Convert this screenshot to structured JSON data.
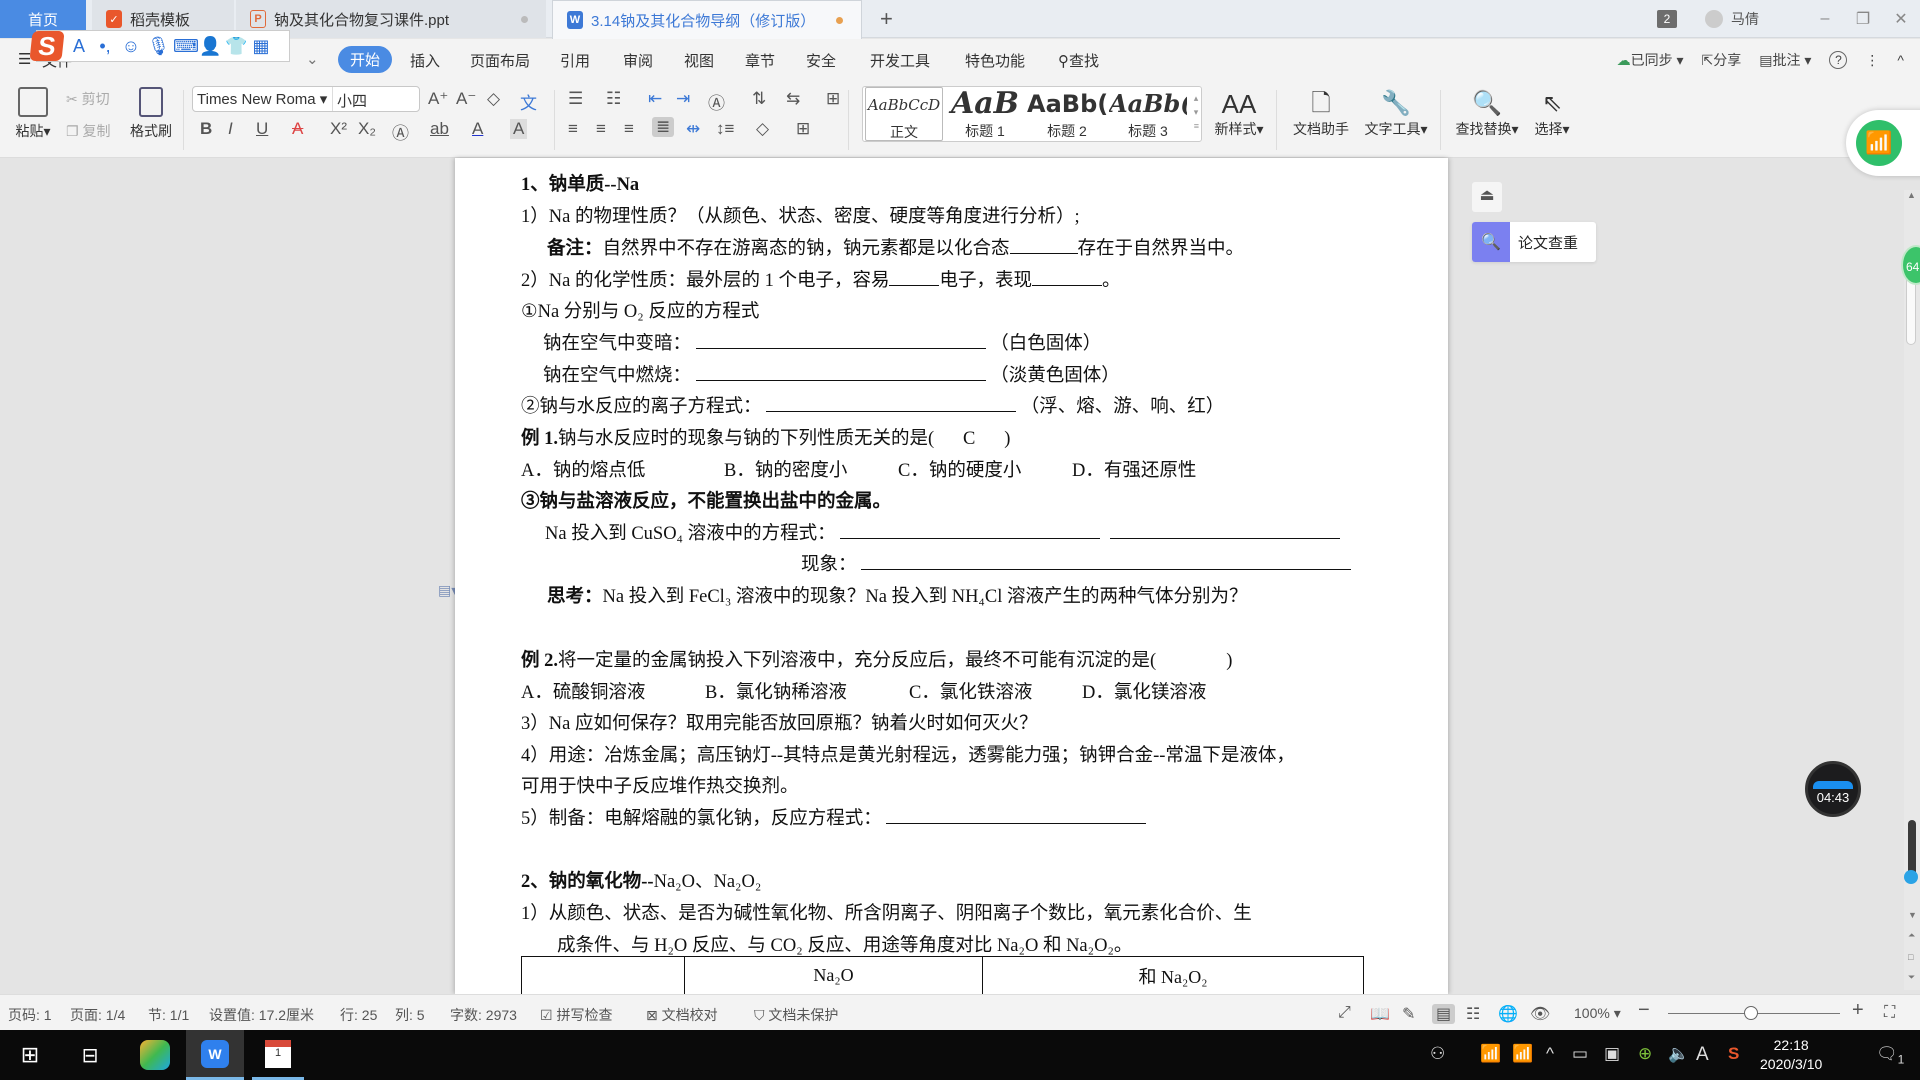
{
  "tabs": {
    "home": "首页",
    "items": [
      {
        "label": "稻壳模板",
        "icon": "docer-icon"
      },
      {
        "label": "钠及其化合物复习课件.ppt",
        "icon": "ppt-icon"
      },
      {
        "label": "3.14钠及其化合物导纲（修订版）",
        "icon": "word-icon",
        "active": true
      }
    ],
    "new_tab": "+"
  },
  "window": {
    "badge": "2",
    "user": "马倩",
    "min": "–",
    "restore": "❐",
    "close": "✕"
  },
  "menu": {
    "file": "文件",
    "items": [
      "开始",
      "插入",
      "页面布局",
      "引用",
      "审阅",
      "视图",
      "章节",
      "安全",
      "开发工具",
      "特色功能",
      "查找"
    ],
    "active": "开始",
    "right": {
      "sync": "已同步",
      "share": "分享",
      "comment": "批注",
      "help": "?",
      "more": "⋮",
      "collapse": "^"
    }
  },
  "ime": {
    "logo": "S"
  },
  "ribbon": {
    "paste": "粘贴",
    "cut": "剪切",
    "copy": "复制",
    "format_painter": "格式刷",
    "font_name": "Times New Roma",
    "font_size": "小四",
    "styles": [
      {
        "preview": "AaBbCcD",
        "label": "正文"
      },
      {
        "preview": "AaB",
        "label": "标题 1"
      },
      {
        "preview": "AaBb(",
        "label": "标题 2"
      },
      {
        "preview": "AaBb(",
        "label": "标题 3"
      }
    ],
    "new_style": "新样式",
    "doc_assistant": "文档助手",
    "text_tools": "文字工具",
    "find_replace": "查找替换",
    "select": "选择"
  },
  "document": {
    "h1": "1、钠单质--Na",
    "l1": "1）Na 的物理性质？（从颜色、状态、密度、硬度等角度进行分析）;",
    "note_label": "备注：",
    "note_a": "自然界中不存在游离态的钠，钠元素都是以化合态",
    "note_b": "存在于自然界当中。",
    "l2a": "2）Na 的化学性质：最外层的 1 个电子，容易",
    "l2b": "电子，表现",
    "l2c": "。",
    "o2_title": "①Na 分别与 O₂ 反应的方程式",
    "air_dark": "钠在空气中变暗：",
    "air_dark_hint": "（白色固体）",
    "air_burn": "钠在空气中燃烧：",
    "air_burn_hint": "（淡黄色固体）",
    "water": "②钠与水反应的离子方程式：",
    "water_hint": "（浮、熔、游、响、红）",
    "ex1_label": "例 1.",
    "ex1": "钠与水反应时的现象与钠的下列性质无关的是(",
    "ex1_answer": "C",
    "ex1_close": ")",
    "ex1_options": [
      "A．钠的熔点低",
      "B．钠的密度小",
      "C．钠的硬度小",
      "D．有强还原性"
    ],
    "salt": "③钠与盐溶液反应，不能置换出盐中的金属。",
    "cuso4": "Na 投入到 CuSO₄ 溶液中的方程式：",
    "phenomenon": "现象：",
    "think_label": "思考：",
    "think": "Na 投入到 FeCl₃ 溶液中的现象？Na 投入到 NH₄Cl 溶液产生的两种气体分别为？",
    "ex2_label": "例 2.",
    "ex2": "将一定量的金属钠投入下列溶液中，充分反应后，最终不可能有沉淀的是(",
    "ex2_close": ")",
    "ex2_options": [
      "A．硫酸铜溶液",
      "B．氯化钠稀溶液",
      "C．氯化铁溶液",
      "D．氯化镁溶液"
    ],
    "l3": "3）Na 应如何保存？取用完能否放回原瓶？钠着火时如何灭火？",
    "l4a": "4）用途：冶炼金属；高压钠灯--其特点是黄光射程远，透雾能力强；钠钾合金--常温下是液体，",
    "l4b": "可用于快中子反应堆作热交换剂。",
    "l5": "5）制备：电解熔融的氯化钠，反应方程式：",
    "h2_bold": "2、钠的氧化物--",
    "h2_rest": "Na₂O、Na₂O₂",
    "o1a": "1）从颜色、状态、是否为碱性氧化物、所含阴离子、阴阳离子个数比，氧元素化合价、生",
    "o1b": "成条件、与 H₂O 反应、与 CO₂ 反应、用途等角度对比 Na₂O 和 Na₂O₂。",
    "table_header": [
      "",
      "Na₂O",
      "和 Na₂O₂"
    ]
  },
  "side": {
    "collapse": "⏏",
    "paper_check": "论文查重",
    "timer": "04:43",
    "green_ball": "64"
  },
  "status": {
    "page_no": "页码: 1",
    "page": "页面: 1/4",
    "section": "节: 1/1",
    "setting": "设置值: 17.2厘米",
    "row": "行: 25",
    "col": "列: 5",
    "words": "字数: 2973",
    "spell": "拼写检查",
    "proof": "文档校对",
    "protect": "文档未保护",
    "zoom": "100%",
    "zoom_value_percent": 100
  },
  "taskbar": {
    "time": "22:18",
    "date": "2020/3/10",
    "notifications": "1"
  },
  "colors": {
    "accent": "#4a8be3",
    "word_blue": "#3d79d6",
    "wps_red": "#e9572c",
    "paper_purple": "#7b80f0",
    "wifi_green": "#2fbf6a"
  }
}
